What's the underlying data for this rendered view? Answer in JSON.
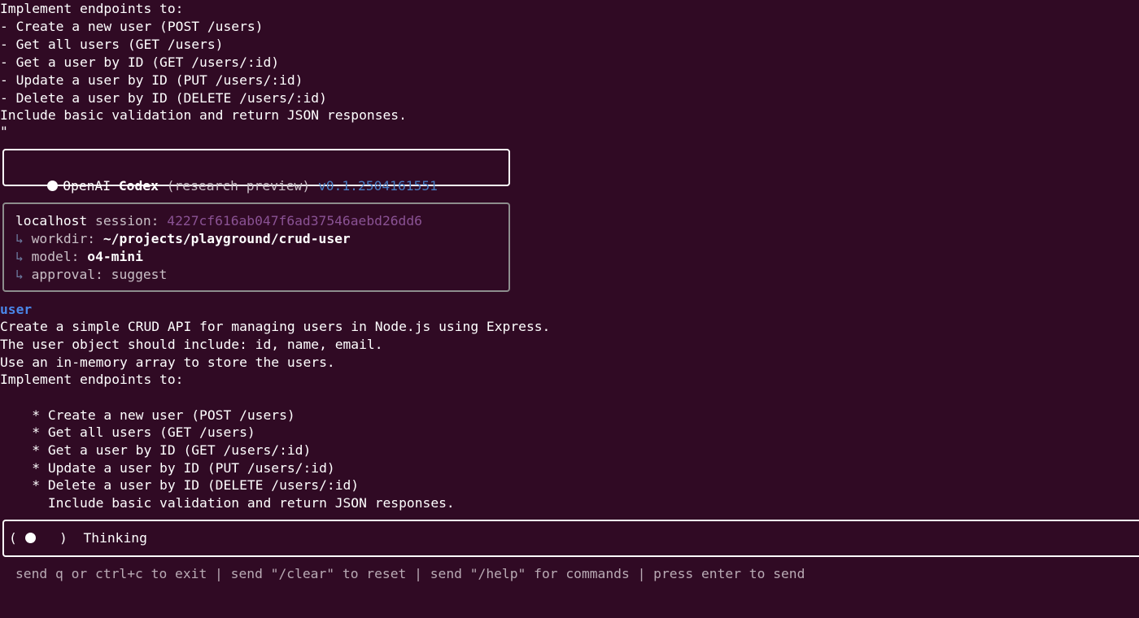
{
  "previous_prompt": {
    "lines": [
      "Implement endpoints to:",
      "- Create a new user (POST /users)",
      "- Get all users (GET /users)",
      "- Get a user by ID (GET /users/:id)",
      "- Update a user by ID (PUT /users/:id)",
      "- Delete a user by ID (DELETE /users/:id)",
      "Include basic validation and return JSON responses.",
      "\""
    ]
  },
  "header": {
    "brand": "OpenAI",
    "product": "Codex",
    "tag": "(research preview)",
    "version": "v0.1.2504161551"
  },
  "session": {
    "host": "localhost",
    "session_label": "session:",
    "session_id": "4227cf616ab047f6ad37546aebd26dd6",
    "arrow": "↳",
    "workdir_label": "workdir:",
    "workdir": "~/projects/playground/crud-user",
    "model_label": "model:",
    "model": "o4-mini",
    "approval_label": "approval:",
    "approval": "suggest"
  },
  "message": {
    "role": "user",
    "lines": [
      "Create a simple CRUD API for managing users in Node.js using Express.",
      "The user object should include: id, name, email.",
      "Use an in-memory array to store the users.",
      "Implement endpoints to:",
      "",
      "    * Create a new user (POST /users)",
      "    * Get all users (GET /users)",
      "    * Get a user by ID (GET /users/:id)",
      "    * Update a user by ID (PUT /users/:id)",
      "    * Delete a user by ID (DELETE /users/:id)",
      "      Include basic validation and return JSON responses."
    ]
  },
  "status": {
    "paren_open": "(",
    "paren_close": ")",
    "text": "Thinking"
  },
  "footer": {
    "hint": "send q or ctrl+c to exit | send \"/clear\" to reset | send \"/help\" for commands | press enter to send"
  },
  "colors": {
    "background": "#300a24",
    "user_role": "#4a86e8",
    "version": "#4a7fc4",
    "session_id": "#8a5294"
  }
}
